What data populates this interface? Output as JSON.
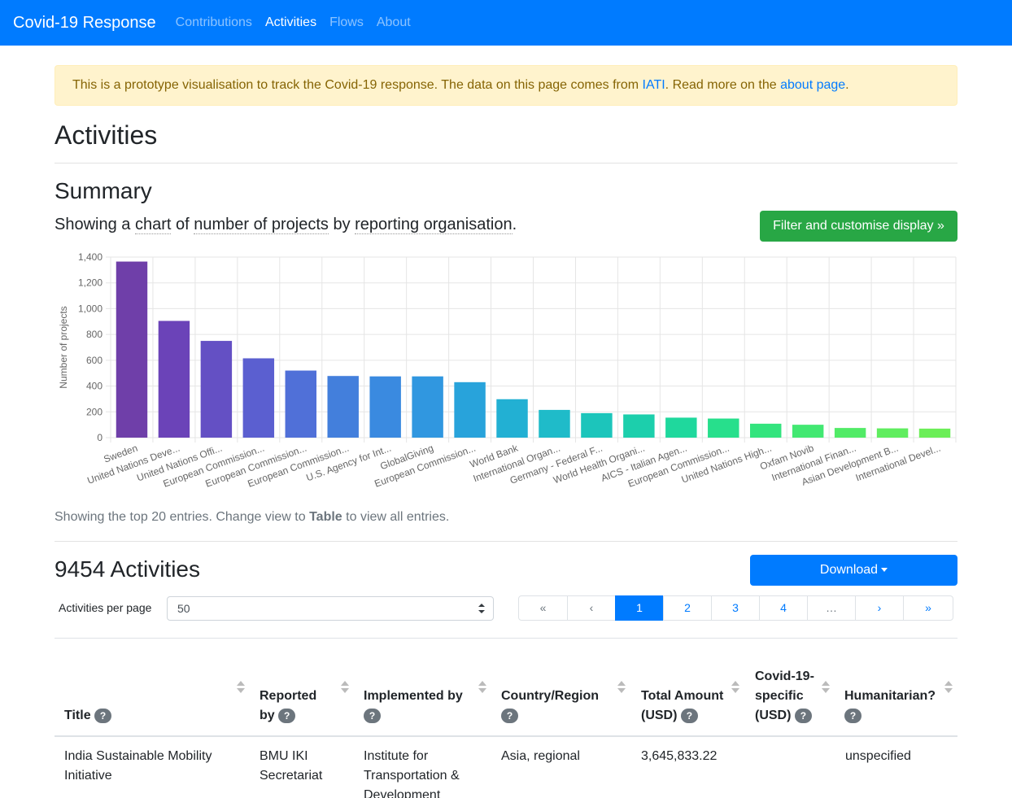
{
  "nav": {
    "brand": "Covid-19 Response",
    "links": [
      "Contributions",
      "Activities",
      "Flows",
      "About"
    ]
  },
  "alert": {
    "text1": "This is a prototype visualisation to track the Covid-19 response. The data on this page comes from ",
    "iati": "IATI",
    "text2": ". Read more on the ",
    "about": "about page",
    "text3": "."
  },
  "page_title": "Activities",
  "summary": {
    "title": "Summary",
    "showing": "Showing a",
    "chart": "chart",
    "of": "of",
    "measure": "number of projects",
    "by": "by",
    "dimension": "reporting organisation",
    "end": ".",
    "filter_button": "Filter and customise display »"
  },
  "chart_data": {
    "type": "bar",
    "ylabel": "Number of projects",
    "ylim": [
      0,
      1400
    ],
    "yticks": [
      "0",
      "200",
      "400",
      "600",
      "800",
      "1,000",
      "1,200",
      "1,400"
    ],
    "categories": [
      "Sweden",
      "United Nations Deve...",
      "United Nations Offi...",
      "European Commission...",
      "European Commission...",
      "European Commission...",
      "U.S. Agency for Int...",
      "GlobalGiving",
      "European Commission...",
      "World Bank",
      "International Organ...",
      "Germany - Federal F...",
      "World Health Organi...",
      "AICS - Italian Agen...",
      "European Commission...",
      "United Nations High...",
      "Oxfam Novib",
      "International Finan...",
      "Asian Development B...",
      "International Devel..."
    ],
    "values": [
      1365,
      905,
      750,
      615,
      520,
      478,
      475,
      475,
      430,
      298,
      215,
      190,
      180,
      155,
      148,
      108,
      100,
      75,
      72,
      70
    ],
    "colors": [
      "#6f3fa9",
      "#6b43b8",
      "#6450c4",
      "#5b5fd0",
      "#5070d8",
      "#437fdc",
      "#3a8ae0",
      "#3097e0",
      "#28a3db",
      "#22b0d3",
      "#1fbbc9",
      "#1cc5bb",
      "#1ccfac",
      "#1fd89d",
      "#27df8c",
      "#33e47e",
      "#42e872",
      "#52eb67",
      "#60ed5f",
      "#6cee58"
    ],
    "grid": true
  },
  "chart_note": {
    "text1": "Showing the top 20 entries. Change view to ",
    "bold": "Table",
    "text2": " to view all entries."
  },
  "activities": {
    "title": "9454 Activities",
    "download": "Download",
    "per_page_label": "Activities per page",
    "per_page_value": "50",
    "pages": [
      "«",
      "‹",
      "1",
      "2",
      "3",
      "4",
      "…",
      "›",
      "»"
    ]
  },
  "table": {
    "headers": [
      "Title",
      "Reported by",
      "Implemented by",
      "Country/Region",
      "Total Amount (USD)",
      "Covid-19-specific (USD)",
      "Humanitarian?"
    ],
    "row": {
      "title": "India Sustainable Mobility Initiative",
      "reported_by": "BMU IKI Secretariat",
      "implemented_by": "Institute for Transportation & Development",
      "country": "Asia, regional",
      "total": "3,645,833.22",
      "covid": "",
      "humanitarian": "unspecified"
    }
  }
}
